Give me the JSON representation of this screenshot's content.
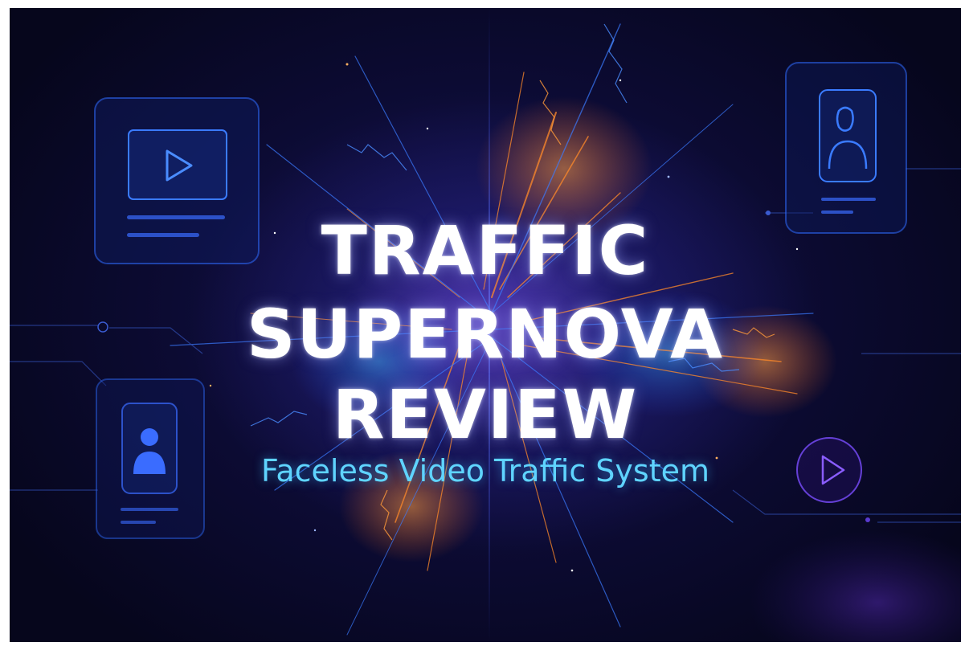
{
  "title_lines": [
    "TRAFFIC",
    "SUPERNOVA",
    "REVIEW"
  ],
  "subtitle": "Faceless Video Traffic System",
  "colors": {
    "background": "#0c0b33",
    "title": "#ffffff",
    "subtitle": "#5fd4ff",
    "card_outline": "#2f6cff",
    "burst_orange": "#ff8a2a",
    "burst_blue": "#3a7bff",
    "play_circle": "#7a4dff"
  },
  "icons": [
    "video-play-icon",
    "user-profile-icon",
    "play-circle-icon"
  ]
}
